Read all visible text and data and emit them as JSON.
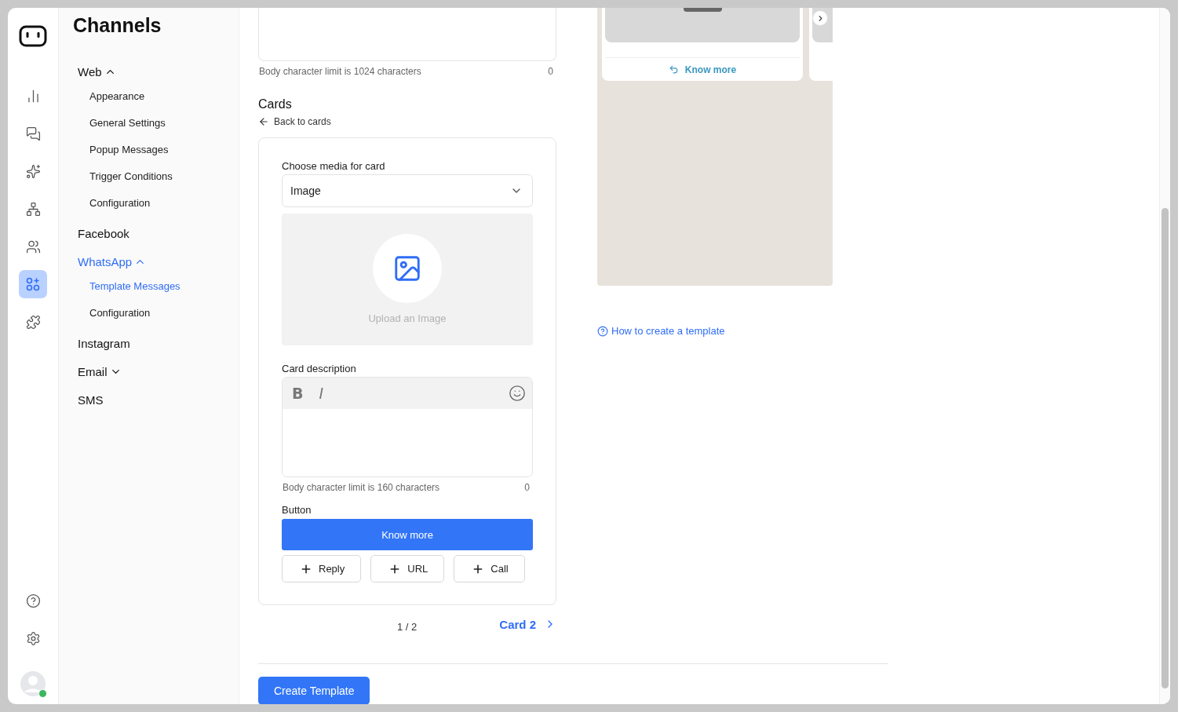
{
  "rail": {
    "top": [
      {
        "kind": "chart",
        "selected": false
      },
      {
        "kind": "chat",
        "selected": false
      },
      {
        "kind": "sparkles",
        "selected": false
      },
      {
        "kind": "network",
        "selected": false
      },
      {
        "kind": "users",
        "selected": false
      },
      {
        "kind": "apps",
        "selected": true
      },
      {
        "kind": "puzzle",
        "selected": false
      }
    ],
    "bottom": [
      {
        "kind": "help"
      },
      {
        "kind": "settings"
      }
    ],
    "avatar": {
      "online": true
    }
  },
  "nav": {
    "title": "Channels",
    "sections": [
      {
        "label": "Web",
        "selected": false,
        "expanded": true,
        "children": [
          {
            "label": "Appearance",
            "selected": false
          },
          {
            "label": "General Settings",
            "selected": false
          },
          {
            "label": "Popup Messages",
            "selected": false
          },
          {
            "label": "Trigger Conditions",
            "selected": false
          },
          {
            "label": "Configuration",
            "selected": false
          }
        ]
      },
      {
        "label": "Facebook",
        "selected": false
      },
      {
        "label": "WhatsApp",
        "selected": true,
        "expanded": true,
        "children": [
          {
            "label": "Template Messages",
            "selected": true
          },
          {
            "label": "Configuration",
            "selected": false
          }
        ]
      },
      {
        "label": "Instagram",
        "selected": false
      },
      {
        "label": "Email",
        "selected": false,
        "expanded": false
      },
      {
        "label": "SMS",
        "selected": false
      }
    ]
  },
  "form": {
    "body_hint": "Body character limit is 1024 characters",
    "body_count": "0",
    "cards_title": "Cards",
    "back_link": "Back to cards",
    "card": {
      "media_label": "Choose media for card",
      "media_value": "Image",
      "upload_text": "Upload an Image",
      "description_label": "Card description",
      "formatting": [
        {
          "kind": "bold",
          "label": "B"
        },
        {
          "kind": "italic",
          "label": "I"
        }
      ],
      "description_hint": "Body character limit is 160 characters",
      "description_count": "0",
      "button_label": "Button",
      "button_value": "Know more",
      "add_buttons": [
        "Reply",
        "URL",
        "Call"
      ]
    },
    "pager": "1 / 2",
    "next_card": "Card 2",
    "submit": "Create Template"
  },
  "preview": {
    "reply_button": "Know more",
    "help_link": "How to create a template"
  }
}
